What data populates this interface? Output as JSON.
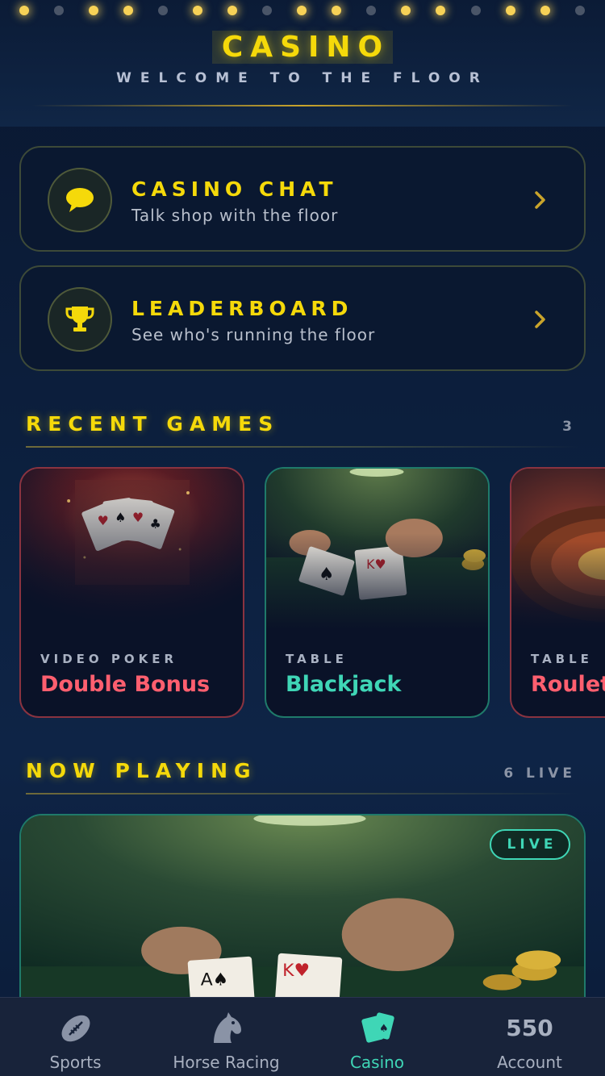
{
  "header": {
    "title": "CASINO",
    "subtitle": "WELCOME TO THE FLOOR"
  },
  "menu": [
    {
      "title": "CASINO CHAT",
      "subtitle": "Talk shop with the floor",
      "icon": "chat-bubble-icon"
    },
    {
      "title": "LEADERBOARD",
      "subtitle": "See who's running the floor",
      "icon": "trophy-icon"
    }
  ],
  "recent": {
    "title": "RECENT GAMES",
    "count": "3",
    "games": [
      {
        "category": "VIDEO POKER",
        "name": "Double Bonus",
        "accent": "#ff5f6f"
      },
      {
        "category": "TABLE",
        "name": "Blackjack",
        "accent": "#3fd6b6"
      },
      {
        "category": "TABLE",
        "name": "Roulette",
        "accent": "#ff5f6f"
      }
    ]
  },
  "now_playing": {
    "title": "NOW PLAYING",
    "count": "6 LIVE",
    "badge": "LIVE"
  },
  "tabs": [
    {
      "label": "Sports",
      "icon": "football-icon"
    },
    {
      "label": "Horse Racing",
      "icon": "horse-head-icon"
    },
    {
      "label": "Casino",
      "icon": "playing-cards-icon",
      "active": true
    },
    {
      "label": "Account",
      "balance": "550"
    }
  ],
  "colors": {
    "gold": "#f5d90a",
    "teal": "#3fd6b6",
    "coral": "#ff5f6f",
    "background": "#0c1f3d"
  }
}
